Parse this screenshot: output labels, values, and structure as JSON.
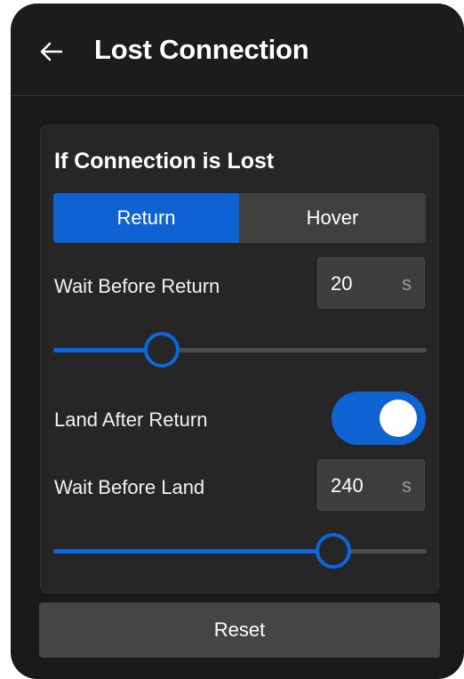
{
  "header": {
    "title": "Lost Connection",
    "back_icon": "arrow-left-icon"
  },
  "connection_lost": {
    "title": "If Connection is Lost",
    "mode_options": [
      "Return",
      "Hover"
    ],
    "selected_mode": "Return"
  },
  "wait_before_return": {
    "label": "Wait Before Return",
    "value": "20",
    "unit": "s",
    "slider_fraction": 0.29
  },
  "land_after_return": {
    "label": "Land After Return",
    "enabled": true
  },
  "wait_before_land": {
    "label": "Wait Before Land",
    "value": "240",
    "unit": "s",
    "slider_fraction": 0.75
  },
  "actions": {
    "reset_label": "Reset"
  },
  "colors": {
    "accent": "#0f62d1",
    "background": "#191919",
    "card": "#262626"
  }
}
